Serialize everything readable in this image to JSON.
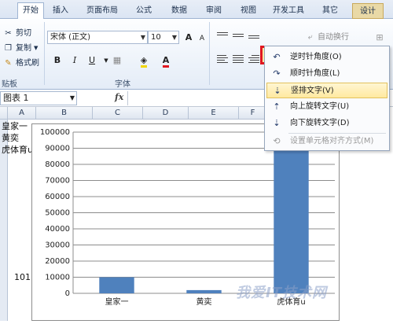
{
  "tabs": {
    "home": "开始",
    "insert": "插入",
    "layout": "页面布局",
    "formulas": "公式",
    "data": "数据",
    "review": "审阅",
    "view": "视图",
    "developer": "开发工具",
    "other": "其它",
    "design": "设计"
  },
  "clipboard": {
    "cut": "剪切",
    "copy": "复制",
    "format_painter": "格式刷",
    "group_label": "贴板"
  },
  "font": {
    "name": "宋体 (正文)",
    "size": "10",
    "bold": "B",
    "italic": "I",
    "underline": "U",
    "group_label": "字体",
    "grow": "A",
    "shrink": "A",
    "font_color_glyph": "A"
  },
  "alignment": {
    "wrap_text": "自动换行"
  },
  "formula_bar": {
    "name_box": "图表 1",
    "fx": "fx"
  },
  "columns": [
    "A",
    "B",
    "C",
    "D",
    "E",
    "F"
  ],
  "cells": {
    "a1": "皇家一",
    "a2": "黄奕",
    "a3": "虎体育u",
    "a_bottom": "101."
  },
  "menu": {
    "items": [
      {
        "label": "逆时针角度(O)",
        "icon": "rotate-counterclockwise-icon"
      },
      {
        "label": "顺时针角度(L)",
        "icon": "rotate-clockwise-icon"
      },
      {
        "label": "竖排文字(V)",
        "icon": "vertical-text-icon"
      },
      {
        "label": "向上旋转文字(U)",
        "icon": "rotate-up-icon"
      },
      {
        "label": "向下旋转文字(D)",
        "icon": "rotate-down-icon"
      },
      {
        "label": "设置单元格对齐方式(M)",
        "icon": "format-alignment-icon"
      }
    ]
  },
  "watermark": "我爱IT技术网",
  "colors": {
    "bar": "#4f81bd",
    "highlight_border": "#e0161f"
  },
  "chart_data": {
    "type": "bar",
    "categories": [
      "皇家一",
      "黄奕",
      "虎体育u"
    ],
    "values": [
      10000,
      2000,
      101000
    ],
    "yticks": [
      0,
      10000,
      20000,
      30000,
      40000,
      50000,
      60000,
      70000,
      80000,
      90000,
      100000
    ],
    "ylim": [
      0,
      100000
    ],
    "title": "",
    "xlabel": "",
    "ylabel": "",
    "grid": true
  }
}
